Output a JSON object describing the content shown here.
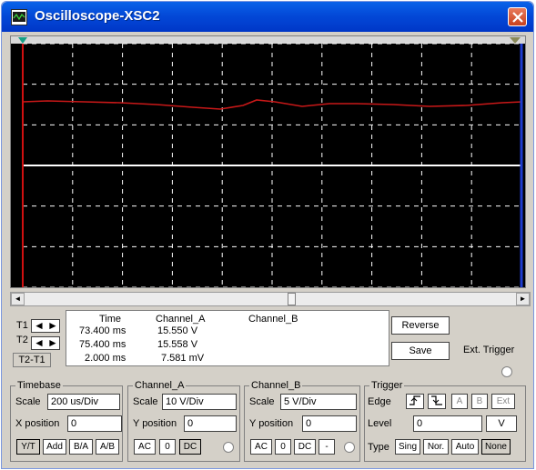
{
  "window": {
    "title": "Oscilloscope-XSC2",
    "icon": "oscilloscope-icon",
    "close_icon": "close-icon",
    "accent": "#0349d8"
  },
  "scope": {
    "background": "#000000",
    "grid_color": "#ffffff",
    "trace_color": "#c81818",
    "t1_cursor_color": "#d01010",
    "t2_cursor_color": "#1e3ccf"
  },
  "scrollbar": {
    "left_icon": "◄",
    "right_icon": "►"
  },
  "readout": {
    "t1_label": "T1",
    "t2_label": "T2",
    "t2t1_label": "T2-T1",
    "arrow_left": "◄",
    "arrow_right": "►",
    "headers": {
      "time": "Time",
      "channel_a": "Channel_A",
      "channel_b": "Channel_B"
    },
    "rows": [
      {
        "time": "73.400 ms",
        "channel_a": "15.550 V",
        "channel_b": ""
      },
      {
        "time": "75.400 ms",
        "channel_a": "15.558 V",
        "channel_b": ""
      },
      {
        "time": "2.000 ms",
        "channel_a": "7.581 mV",
        "channel_b": ""
      }
    ]
  },
  "buttons": {
    "reverse": "Reverse",
    "save": "Save",
    "ext_trigger": "Ext. Trigger"
  },
  "timebase": {
    "legend": "Timebase",
    "scale_label": "Scale",
    "scale_value": "200 us/Div",
    "xpos_label": "X position",
    "xpos_value": "0",
    "modes": [
      "Y/T",
      "Add",
      "B/A",
      "A/B"
    ]
  },
  "channel_a": {
    "legend": "Channel_A",
    "scale_label": "Scale",
    "scale_value": "10  V/Div",
    "ypos_label": "Y position",
    "ypos_value": "0",
    "couplings": [
      "AC",
      "0",
      "DC"
    ]
  },
  "channel_b": {
    "legend": "Channel_B",
    "scale_label": "Scale",
    "scale_value": "5  V/Div",
    "ypos_label": "Y position",
    "ypos_value": "0",
    "couplings": [
      "AC",
      "0",
      "DC",
      "-"
    ]
  },
  "trigger": {
    "legend": "Trigger",
    "edge_label": "Edge",
    "edge_buttons": [
      "A",
      "B",
      "Ext"
    ],
    "level_label": "Level",
    "level_value": "0",
    "level_unit": "V",
    "type_label": "Type",
    "type_values": [
      "Sing",
      "Nor.",
      "Auto",
      "None"
    ]
  }
}
